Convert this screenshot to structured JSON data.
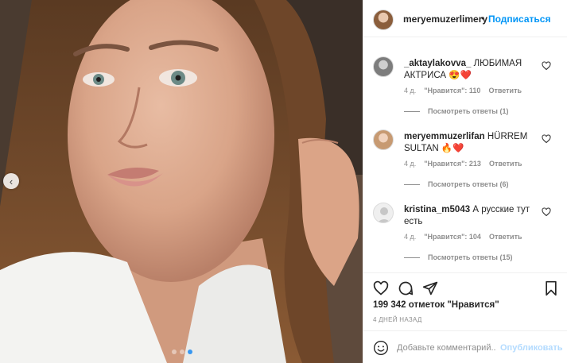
{
  "post": {
    "author": "meryemuzerlimery",
    "separator": "•",
    "follow_label": "Подписаться",
    "likes_text": "199 342 отметок \"Нравится\"",
    "date_text": "4 ДНЕЙ НАЗАД"
  },
  "comments": [
    {
      "user": "_aktaylakovva_",
      "text": "ЛЮБИМАЯ АКТРИСА 😍❤️",
      "age": "4 д.",
      "likes": "\"Нравится\": 110",
      "reply_label": "Ответить",
      "view_replies": "Посмотреть ответы (1)"
    },
    {
      "user": "meryemmuzerlifan",
      "text": "HÜRREM SULTAN 🔥❤️",
      "age": "4 д.",
      "likes": "\"Нравится\": 213",
      "reply_label": "Ответить",
      "view_replies": "Посмотреть ответы (6)"
    },
    {
      "user": "kristina_m5043",
      "text": "А русские тут есть",
      "age": "4 д.",
      "likes": "\"Нравится\": 104",
      "reply_label": "Ответить",
      "view_replies": "Посмотреть ответы (15)"
    }
  ],
  "composer": {
    "placeholder": "Добавьте комментарий...",
    "publish_label": "Опубликовать"
  },
  "icons": {
    "like": "heart-icon",
    "comment": "comment-icon",
    "share": "paper-plane-icon",
    "save": "bookmark-icon",
    "emoji": "smiley-icon",
    "prev": "chevron-left-icon"
  },
  "colors": {
    "accent": "#0095f6",
    "publish_disabled": "#b3dbff",
    "secondary_text": "#8e8e8e",
    "carousel_active_dot": "#3897f0"
  },
  "carousel": {
    "total": 3,
    "active_index": 2
  }
}
